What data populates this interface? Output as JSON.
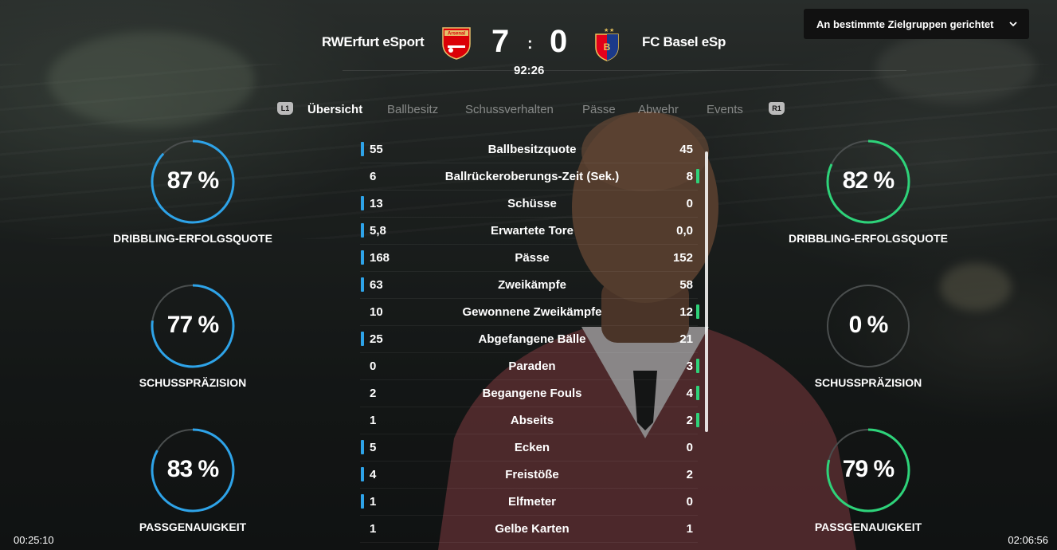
{
  "header": {
    "audience_dropdown": "An bestimmte Zielgruppen gerichtet",
    "home_team": "RWErfurt eSport",
    "away_team": "FC Basel eSp",
    "home_crest_text": "Arsenal",
    "home_score": "7",
    "away_score": "0",
    "score_separator": ":",
    "match_clock": "92:26"
  },
  "tabs": {
    "left_shoulder": "L1",
    "right_shoulder": "R1",
    "items": [
      {
        "label": "Übersicht",
        "active": true
      },
      {
        "label": "Ballbesitz",
        "active": false
      },
      {
        "label": "Schussverhalten",
        "active": false
      },
      {
        "label": "Pässe",
        "active": false
      },
      {
        "label": "Abwehr",
        "active": false
      },
      {
        "label": "Events",
        "active": false
      }
    ]
  },
  "home_rings": [
    {
      "value": "87 %",
      "label": "DRIBBLING-ERFOLGSQUOTE",
      "fraction": 0.87
    },
    {
      "value": "77 %",
      "label": "SCHUSSPRÄZISION",
      "fraction": 0.77
    },
    {
      "value": "83 %",
      "label": "PASSGENAUIGKEIT",
      "fraction": 0.83
    }
  ],
  "away_rings": [
    {
      "value": "82 %",
      "label": "DRIBBLING-ERFOLGSQUOTE",
      "fraction": 0.82
    },
    {
      "value": "0 %",
      "label": "SCHUSSPRÄZISION",
      "fraction": 0.0
    },
    {
      "value": "79 %",
      "label": "PASSGENAUIGKEIT",
      "fraction": 0.79
    }
  ],
  "colors": {
    "home_accent": "#2ea3e8",
    "away_accent": "#2ed37a",
    "ring_track": "#4a4e4e"
  },
  "stats": [
    {
      "left": "55",
      "name": "Ballbesitzquote",
      "right": "45",
      "leader": "left"
    },
    {
      "left": "6",
      "name": "Ballrückeroberungs-Zeit (Sek.)",
      "right": "8",
      "leader": "right"
    },
    {
      "left": "13",
      "name": "Schüsse",
      "right": "0",
      "leader": "left"
    },
    {
      "left": "5,8",
      "name": "Erwartete Tore",
      "right": "0,0",
      "leader": "left"
    },
    {
      "left": "168",
      "name": "Pässe",
      "right": "152",
      "leader": "left"
    },
    {
      "left": "63",
      "name": "Zweikämpfe",
      "right": "58",
      "leader": "left"
    },
    {
      "left": "10",
      "name": "Gewonnene Zweikämpfe",
      "right": "12",
      "leader": "right"
    },
    {
      "left": "25",
      "name": "Abgefangene Bälle",
      "right": "21",
      "leader": "left"
    },
    {
      "left": "0",
      "name": "Paraden",
      "right": "3",
      "leader": "right"
    },
    {
      "left": "2",
      "name": "Begangene Fouls",
      "right": "4",
      "leader": "right"
    },
    {
      "left": "1",
      "name": "Abseits",
      "right": "2",
      "leader": "right"
    },
    {
      "left": "5",
      "name": "Ecken",
      "right": "0",
      "leader": "left"
    },
    {
      "left": "4",
      "name": "Freistöße",
      "right": "2",
      "leader": "left"
    },
    {
      "left": "1",
      "name": "Elfmeter",
      "right": "0",
      "leader": "left"
    },
    {
      "left": "1",
      "name": "Gelbe Karten",
      "right": "1",
      "leader": "none"
    }
  ],
  "player": {
    "elapsed": "00:25:10",
    "duration": "02:06:56"
  }
}
